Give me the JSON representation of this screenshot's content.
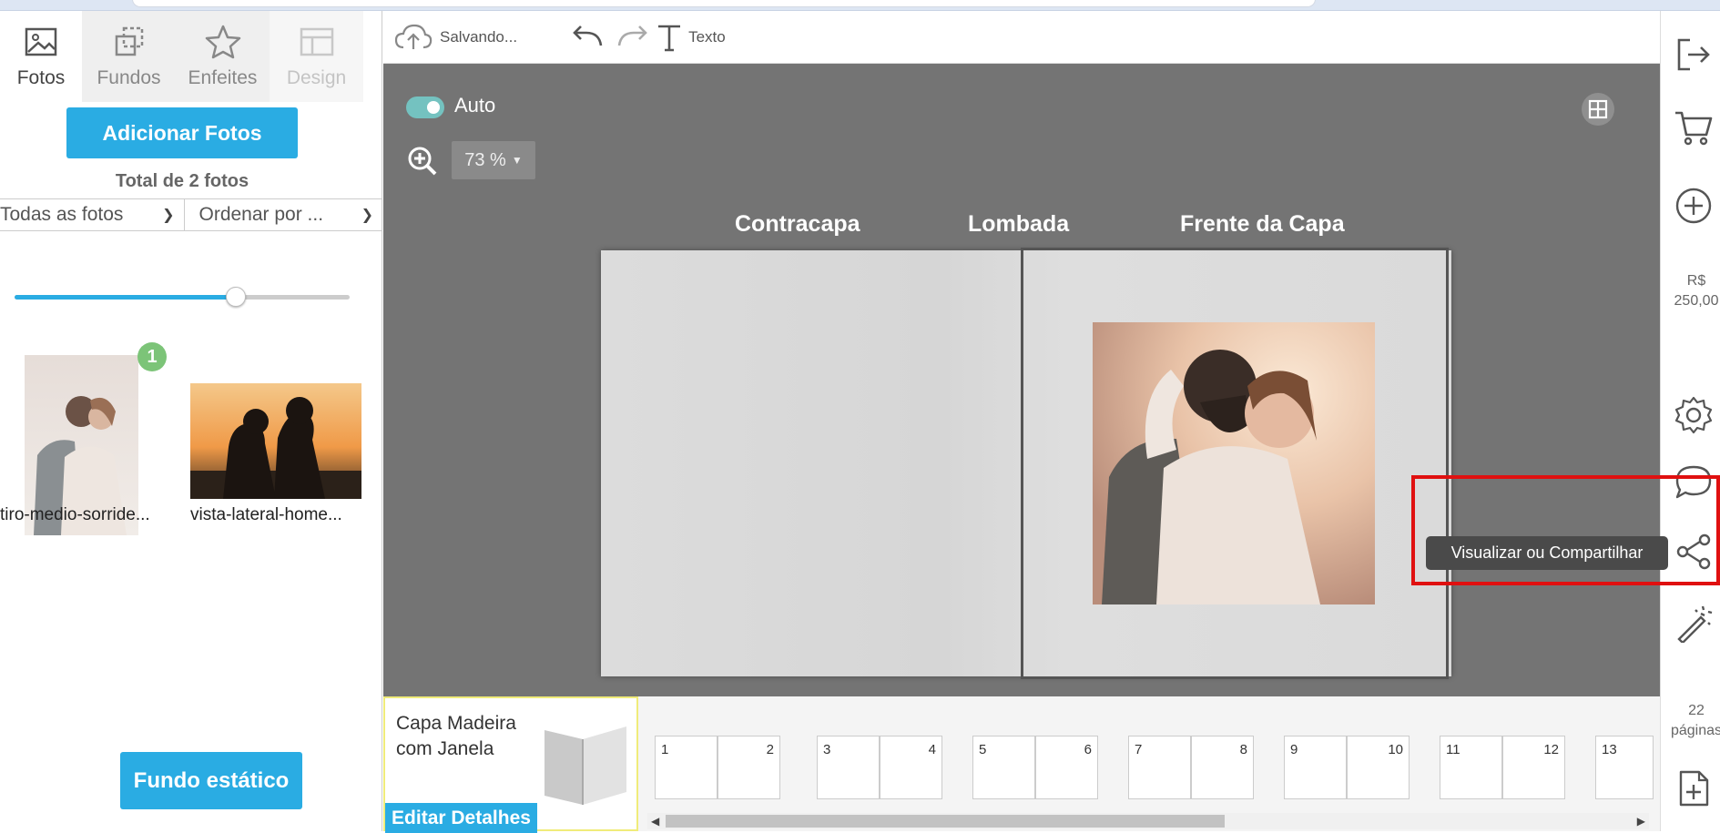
{
  "left_panel": {
    "tabs": [
      {
        "label": "Fotos",
        "icon": "image-icon"
      },
      {
        "label": "Fundos",
        "icon": "backgrounds-icon"
      },
      {
        "label": "Enfeites",
        "icon": "star-icon"
      },
      {
        "label": "Design",
        "icon": "layout-icon"
      }
    ],
    "add_photos_label": "Adicionar Fotos",
    "total_label": "Total de 2 fotos",
    "filter_all": "Todas as fotos",
    "filter_order": "Ordenar por ...",
    "slider_fraction": 0.66,
    "photos": [
      {
        "label": "tiro-medio-sorride...",
        "badge": "1"
      },
      {
        "label": "vista-lateral-home..."
      }
    ],
    "static_bg_label": "Fundo estático"
  },
  "toolbar": {
    "saving_label": "Salvando...",
    "text_label": "Texto"
  },
  "canvas": {
    "auto_label": "Auto",
    "zoom_value": "73 %",
    "labels": {
      "back": "Contracapa",
      "spine": "Lombada",
      "front": "Frente da Capa"
    }
  },
  "strip": {
    "cover_title": "Capa Madeira com Janela",
    "edit_details_label": "Editar Detalhes",
    "pages": [
      [
        "1",
        "2"
      ],
      [
        "3",
        "4"
      ],
      [
        "5",
        "6"
      ],
      [
        "7",
        "8"
      ],
      [
        "9",
        "10"
      ],
      [
        "11",
        "12"
      ],
      [
        "13",
        ""
      ]
    ]
  },
  "rail": {
    "price_currency": "R$",
    "price_value": "250,00",
    "page_count": "22",
    "page_word": "páginas",
    "tooltip": "Visualizar ou Compartilhar"
  },
  "colors": {
    "accent": "#2aace3",
    "canvas_bg": "#747474",
    "badge": "#7cc478",
    "highlight": "#e01010"
  }
}
